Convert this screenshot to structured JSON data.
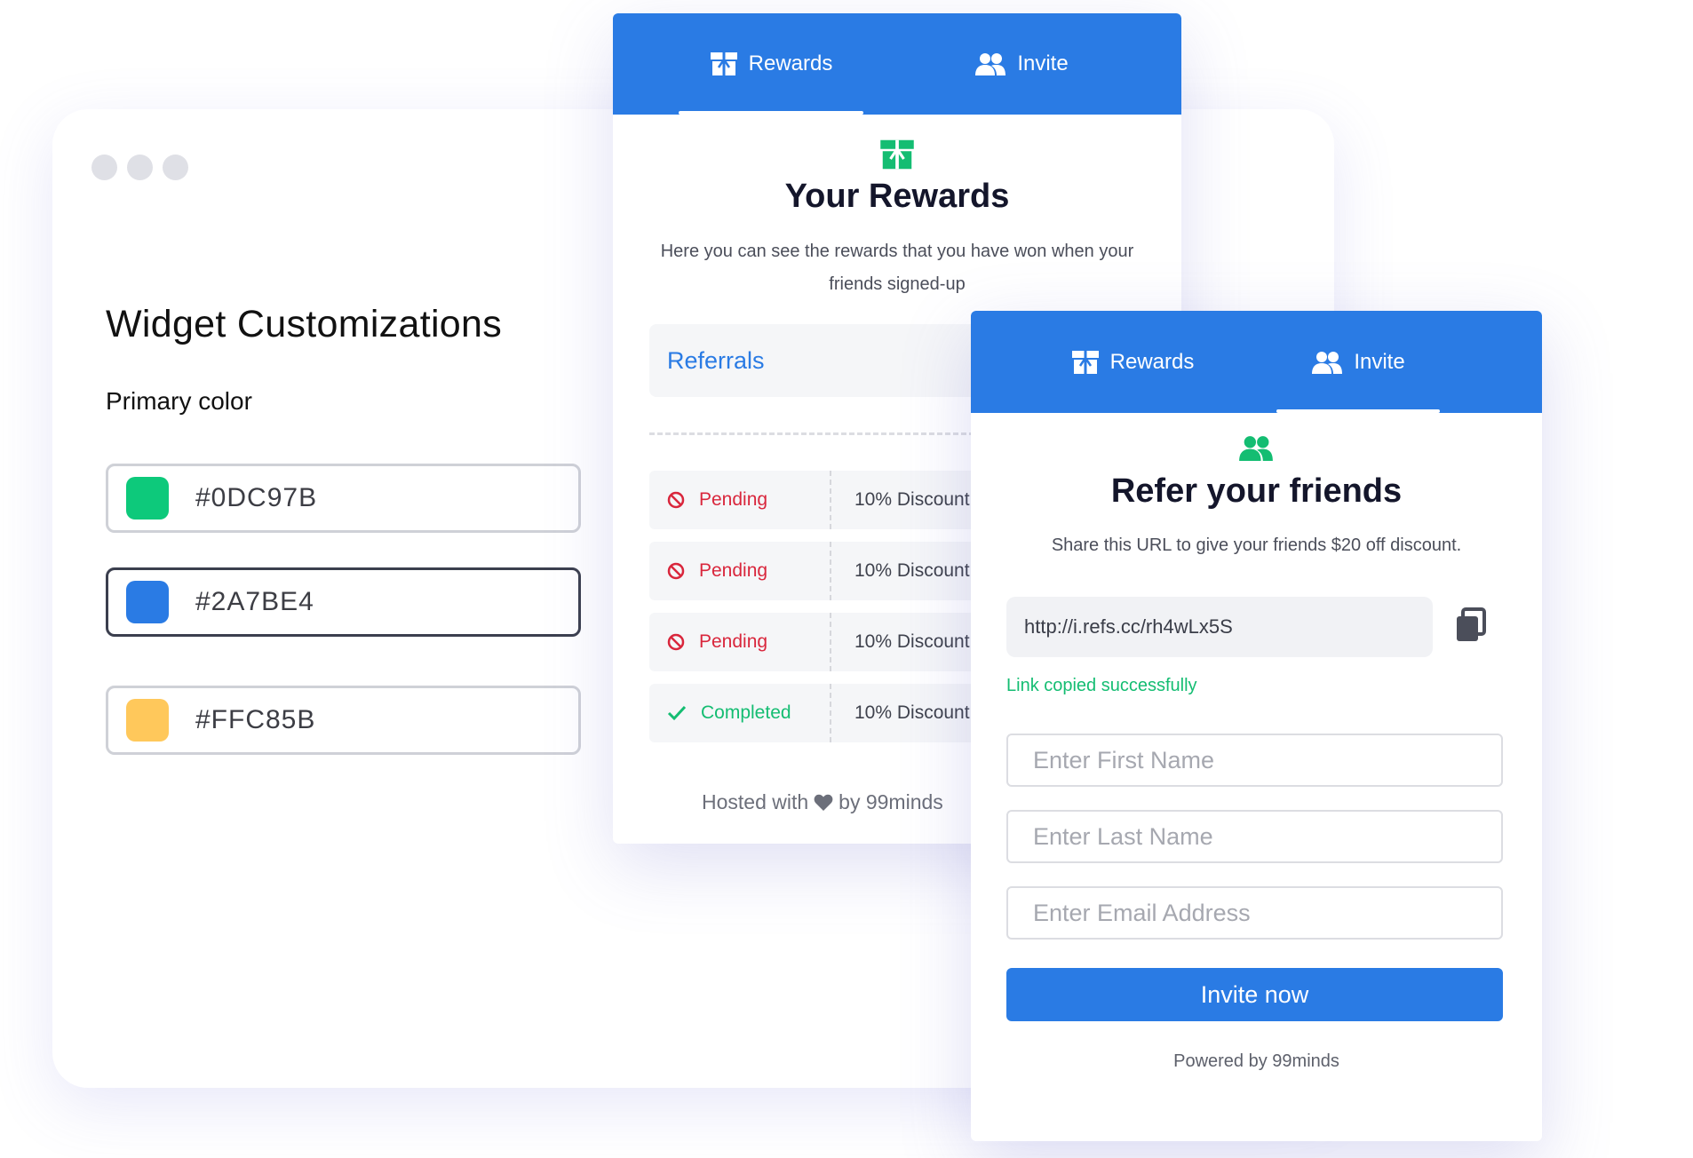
{
  "customization": {
    "title": "Widget Customizations",
    "primary_color_label": "Primary color",
    "colors": [
      {
        "code": "#0DC97B",
        "swatch": "#0DC97B",
        "selected": false
      },
      {
        "code": "#2A7BE4",
        "swatch": "#2A7BE4",
        "selected": true
      },
      {
        "code": "#FFC85B",
        "swatch": "#FFC85B",
        "selected": false
      }
    ]
  },
  "rewards_widget": {
    "tabs": [
      {
        "label": "Rewards",
        "icon": "gift-icon",
        "active": true
      },
      {
        "label": "Invite",
        "icon": "users-icon",
        "active": false
      }
    ],
    "heading_icon": "gift-icon",
    "title": "Your Rewards",
    "description": "Here you can see the rewards that you have won when your friends signed-up",
    "section_label": "Referrals",
    "referrals": [
      {
        "status": "Pending",
        "status_icon": "ban-icon",
        "reward": "10% Discount"
      },
      {
        "status": "Pending",
        "status_icon": "ban-icon",
        "reward": "10% Discount"
      },
      {
        "status": "Pending",
        "status_icon": "ban-icon",
        "reward": "10% Discount"
      },
      {
        "status": "Completed",
        "status_icon": "check-icon",
        "reward": "10% Discount"
      }
    ],
    "footer_before": "Hosted with",
    "footer_icon": "heart-icon",
    "footer_after": "by 99minds"
  },
  "invite_widget": {
    "tabs": [
      {
        "label": "Rewards",
        "icon": "gift-icon",
        "active": false
      },
      {
        "label": "Invite",
        "icon": "users-icon",
        "active": true
      }
    ],
    "heading_icon": "users-icon",
    "title": "Refer your friends",
    "description": "Share this URL to give your friends $20 off discount.",
    "url": "http://i.refs.cc/rh4wLx5S",
    "copy_icon": "copy-icon",
    "copied_message": "Link copied successfully",
    "first_name_placeholder": "Enter First Name",
    "last_name_placeholder": "Enter Last Name",
    "email_placeholder": "Enter Email Address",
    "button_label": "Invite now",
    "powered_by": "Powered by 99minds"
  },
  "colors": {
    "primary_blue": "#2A7BE4",
    "success_green": "#14BD72",
    "pending_red": "#D9263C"
  }
}
